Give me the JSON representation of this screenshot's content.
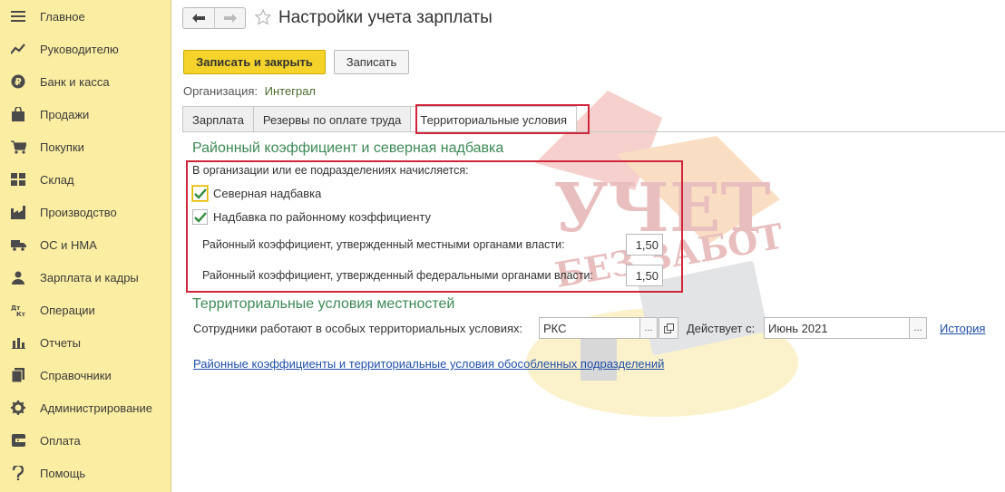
{
  "sidebar": {
    "items": [
      {
        "label": "Главное",
        "icon": "menu-icon"
      },
      {
        "label": "Руководителю",
        "icon": "trend-icon"
      },
      {
        "label": "Банк и касса",
        "icon": "ruble-icon"
      },
      {
        "label": "Продажи",
        "icon": "bag-icon"
      },
      {
        "label": "Покупки",
        "icon": "cart-icon"
      },
      {
        "label": "Склад",
        "icon": "warehouse-icon"
      },
      {
        "label": "Производство",
        "icon": "factory-icon"
      },
      {
        "label": "ОС и НМА",
        "icon": "truck-icon"
      },
      {
        "label": "Зарплата и кадры",
        "icon": "person-icon"
      },
      {
        "label": "Операции",
        "icon": "dt-kt-icon"
      },
      {
        "label": "Отчеты",
        "icon": "bar-chart-icon"
      },
      {
        "label": "Справочники",
        "icon": "books-icon"
      },
      {
        "label": "Администрирование",
        "icon": "gear-icon"
      },
      {
        "label": "Оплата",
        "icon": "wallet-icon"
      },
      {
        "label": "Помощь",
        "icon": "help-icon"
      }
    ]
  },
  "header": {
    "title": "Настройки учета зарплаты"
  },
  "toolbar": {
    "save_close_label": "Записать и закрыть",
    "save_label": "Записать"
  },
  "organization": {
    "label": "Организация:",
    "value": "Интеграл"
  },
  "tabs": [
    {
      "label": "Зарплата"
    },
    {
      "label": "Резервы по оплате труда"
    },
    {
      "label": "Территориальные условия",
      "active": true
    }
  ],
  "regional": {
    "section_title": "Районный коэффициент и северная надбавка",
    "intro": "В организации или ее подразделениях начисляется:",
    "checkbox_north": {
      "label": "Северная надбавка",
      "checked": true
    },
    "checkbox_regional": {
      "label": "Надбавка по районному коэффициенту",
      "checked": true
    },
    "local_label": "Районный коэффициент, утвержденный местными органами власти:",
    "local_value": "1,50",
    "federal_label": "Районный коэффициент, утвержденный федеральными органами власти:",
    "federal_value": "1,50"
  },
  "territorial": {
    "section_title": "Территориальные условия местностей",
    "employees_label": "Сотрудники работают в особых территориальных условиях:",
    "employees_value": "РКС",
    "effective_label": "Действует с:",
    "effective_value": "Июнь 2021",
    "history_link": "История",
    "subdivisions_link": "Районные коэффициенты и территориальные условия обособленных подразделений"
  },
  "watermark": {
    "line1": "УЧЕТ",
    "line2": "БЕЗ ЗАБОТ"
  },
  "colors": {
    "sidebar_bg": "#fbeda1",
    "accent_yellow": "#f5d32b",
    "section_green": "#3c8a55",
    "highlight_red": "#d0263a",
    "link_blue": "#1f4fa8"
  }
}
